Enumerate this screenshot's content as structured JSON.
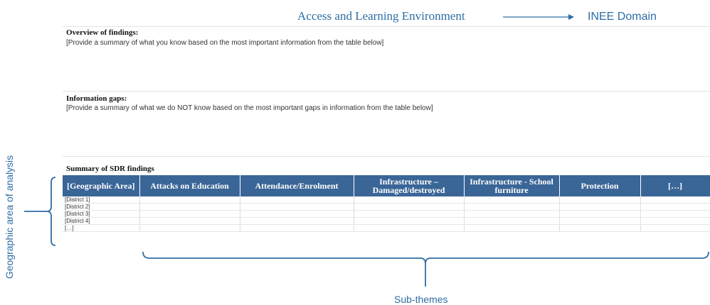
{
  "domain": {
    "title": "Access and Learning Environment",
    "label": "INEE Domain"
  },
  "overview": {
    "heading": "Overview of findings:",
    "body": "[Provide a summary of what you know based on the most important information from the table below]"
  },
  "gaps": {
    "heading": "Information gaps:",
    "body": "[Provide a summary of what we do NOT know based on the most important gaps in information from the table below]"
  },
  "summary": {
    "title": "Summary of SDR findings",
    "columns": [
      "[Geographic Area]",
      "Attacks on Education",
      "Attendance/Enrolment",
      "Infrastructure – Damaged/destroyed",
      "Infrastructure - School furniture",
      "Protection",
      "[…]"
    ],
    "rows": [
      "[District 1]",
      "[District 2]",
      "[District 3]",
      "[District 4]",
      "[…]"
    ]
  },
  "annotations": {
    "left": "Geographic area of analysis",
    "bottom": "Sub-themes"
  },
  "colors": {
    "accent": "#2e6da4",
    "header_fill": "#3a6597"
  }
}
